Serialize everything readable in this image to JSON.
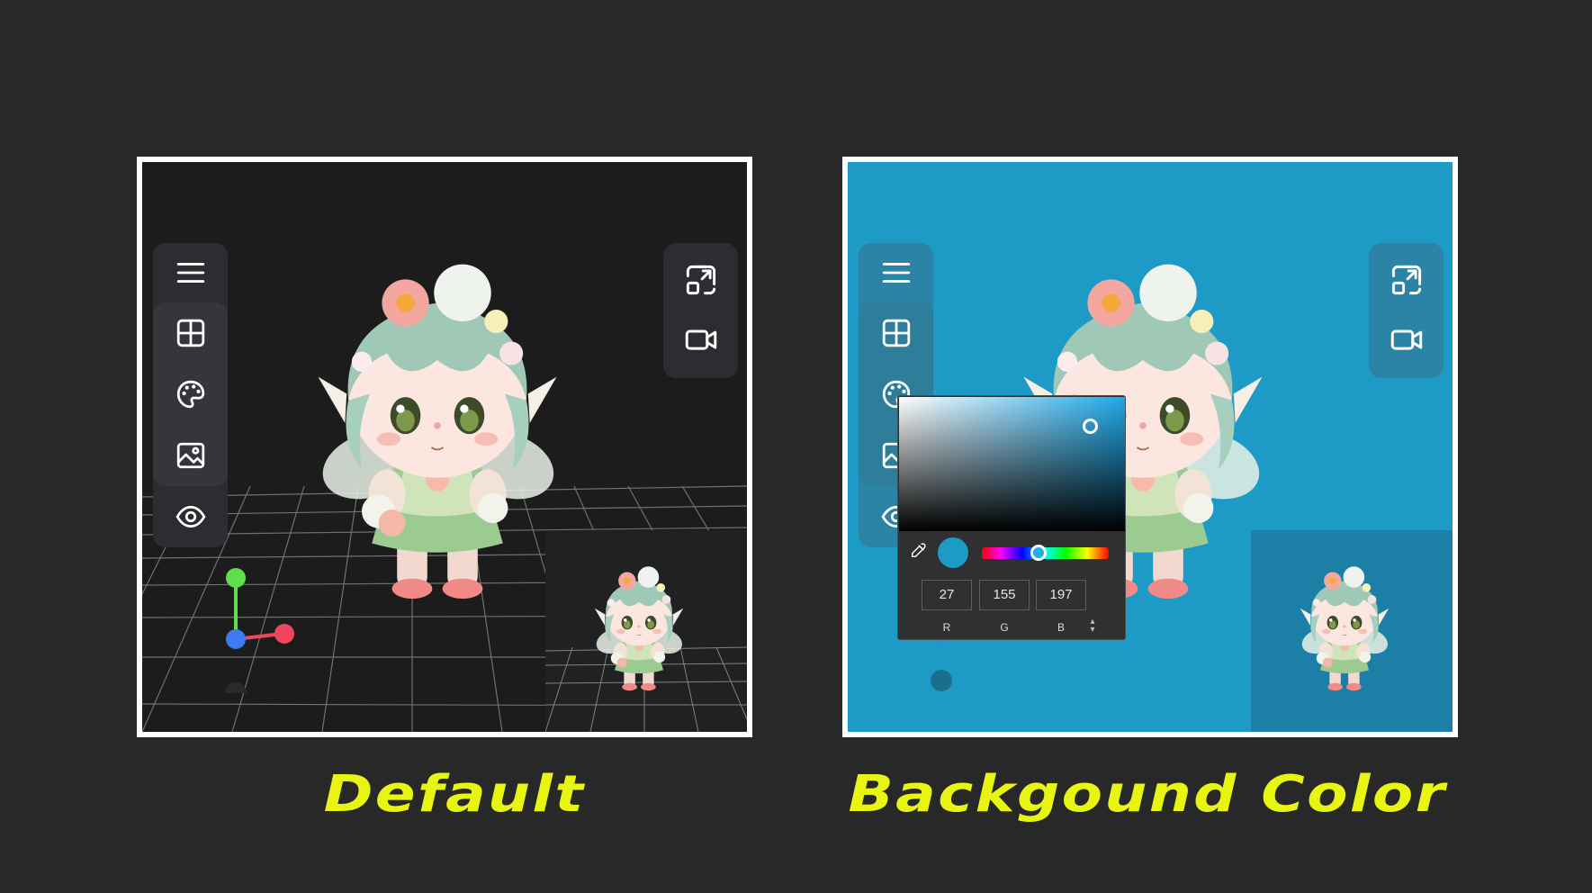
{
  "captions": {
    "default": "Default",
    "background_color": "Backgound Color"
  },
  "toolbar_left": {
    "items": [
      {
        "icon": "menu-icon"
      },
      {
        "icon": "grid-view-icon"
      },
      {
        "icon": "palette-icon"
      },
      {
        "icon": "image-icon"
      },
      {
        "icon": "eye-icon"
      }
    ]
  },
  "toolbar_right": {
    "items": [
      {
        "icon": "fullscreen-icon"
      },
      {
        "icon": "video-camera-icon"
      }
    ]
  },
  "color_picker": {
    "r": "27",
    "g": "155",
    "b": "197",
    "r_label": "R",
    "g_label": "G",
    "b_label": "B",
    "swatch": "#1b9bc5"
  },
  "colors": {
    "default_background": "#1c1c1d",
    "custom_background": "#1e9ac6",
    "caption": "#e8f512",
    "frame": "#ffffff",
    "axis_x": "#f0465a",
    "axis_y": "#5fe04a",
    "axis_z": "#3d7bf2"
  }
}
